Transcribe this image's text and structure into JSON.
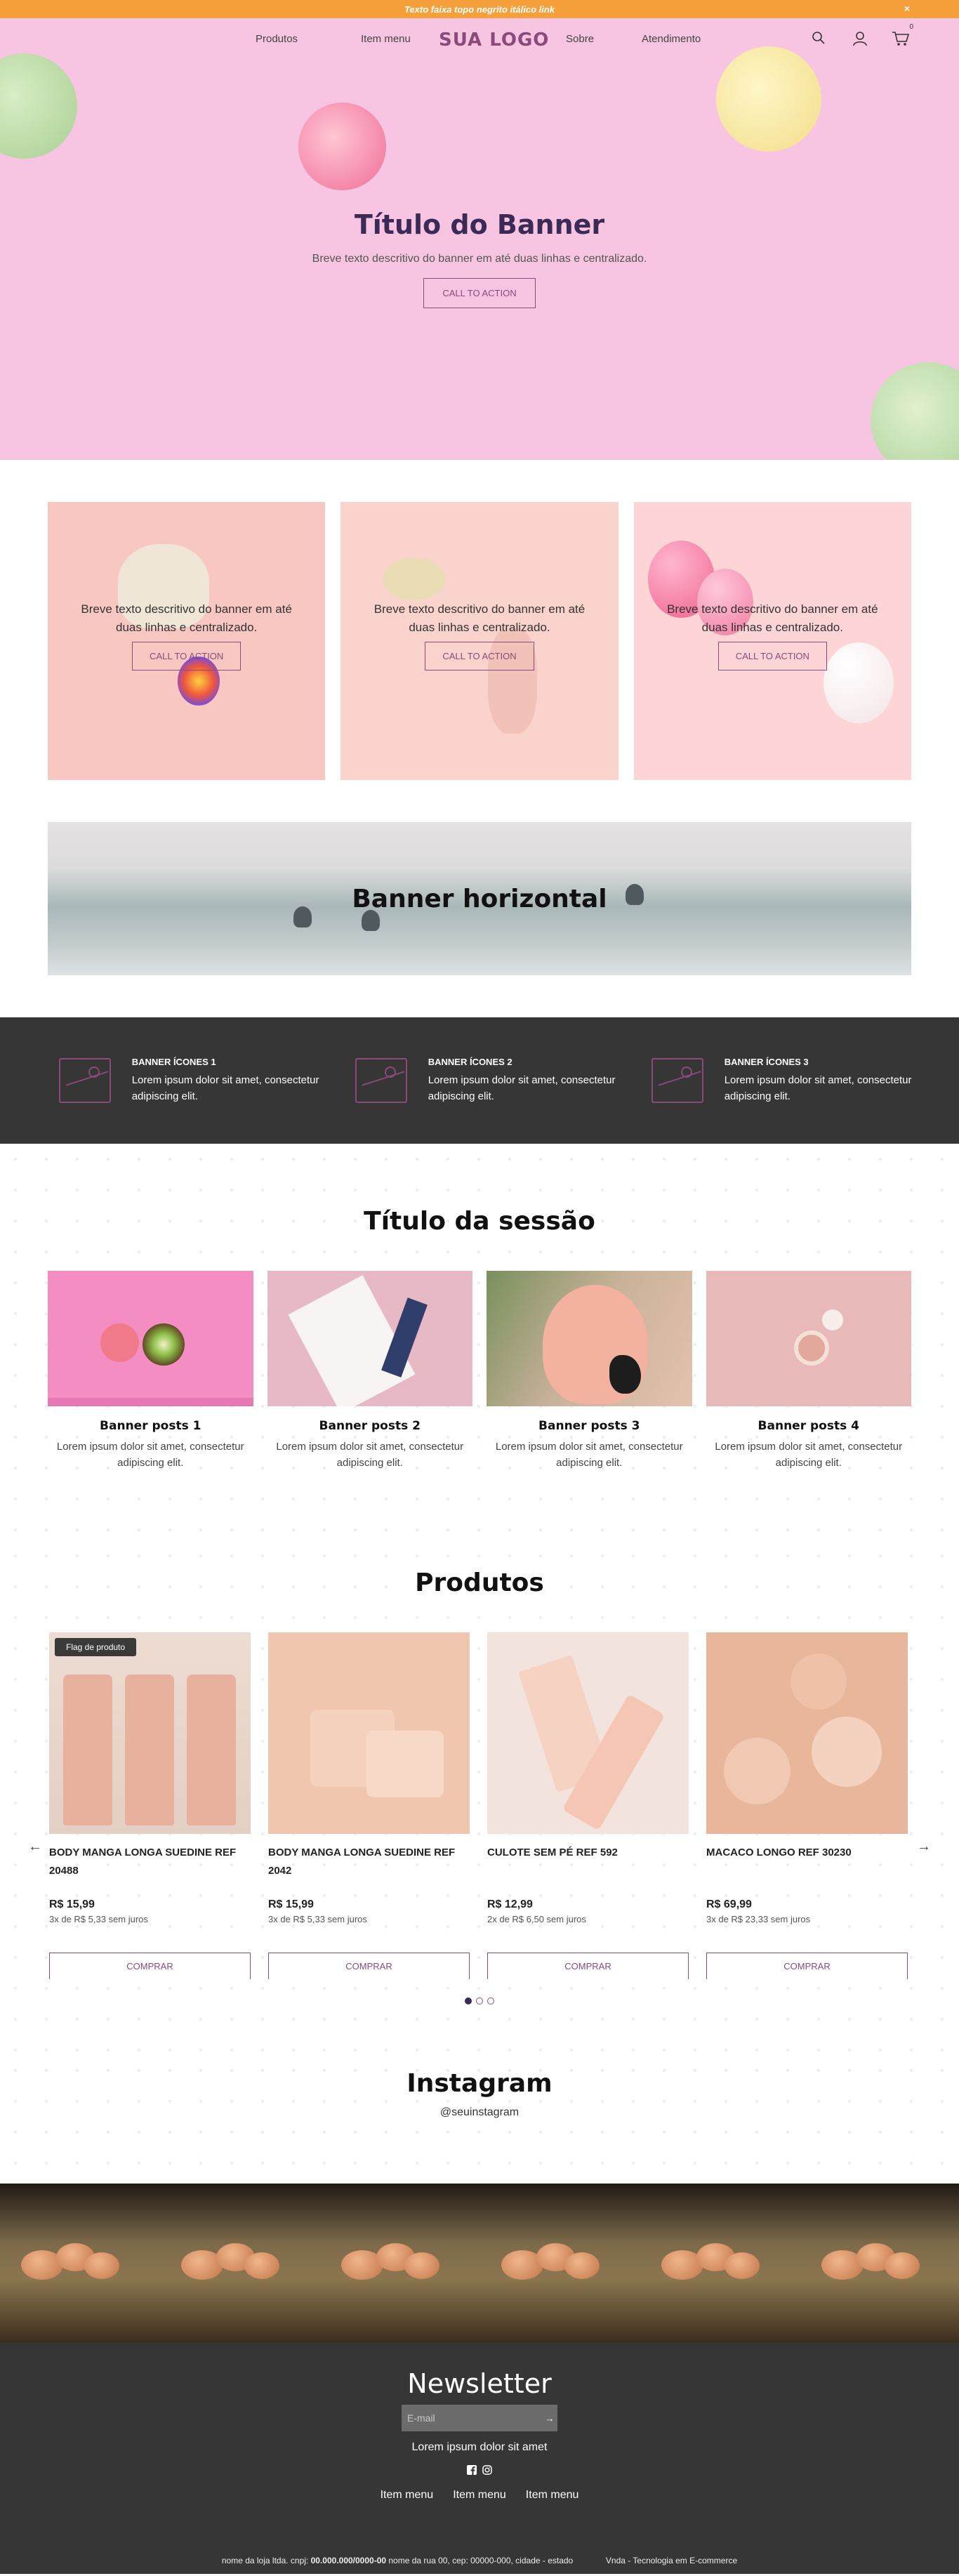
{
  "topbar": {
    "text": "Texto faixa topo negrito itálico link",
    "close_symbol": "×"
  },
  "header": {
    "nav_left": [
      "Produtos",
      "Item menu"
    ],
    "logo": "SUA LOGO",
    "nav_right": [
      "Sobre",
      "Atendimento"
    ],
    "cart_count": "0",
    "icons": [
      "search-icon",
      "user-icon",
      "cart-icon"
    ]
  },
  "hero": {
    "title": "Título do Banner",
    "text": "Breve texto descritivo do banner em até duas linhas e centralizado.",
    "cta": "CALL TO ACTION"
  },
  "banners": [
    {
      "text": "Breve texto descritivo do banner em até duas linhas e centralizado.",
      "cta": "CALL TO ACTION"
    },
    {
      "text": "Breve texto descritivo do banner em até duas linhas e centralizado.",
      "cta": "CALL TO ACTION"
    },
    {
      "text": "Breve texto descritivo do banner em até duas linhas e centralizado.",
      "cta": "CALL TO ACTION"
    }
  ],
  "horizontal_banner": {
    "title": "Banner horizontal"
  },
  "icon_banners": [
    {
      "title": "BANNER ÍCONES 1",
      "text": "Lorem ipsum dolor sit amet, consectetur adipiscing elit."
    },
    {
      "title": "BANNER ÍCONES 2",
      "text": "Lorem ipsum dolor sit amet, consectetur adipiscing elit."
    },
    {
      "title": "BANNER ÍCONES 3",
      "text": "Lorem ipsum dolor sit amet, consectetur adipiscing elit."
    }
  ],
  "posts_section": {
    "title": "Título da sessão",
    "posts": [
      {
        "title": "Banner posts 1",
        "text": "Lorem ipsum dolor sit amet, consectetur adipiscing elit."
      },
      {
        "title": "Banner posts 2",
        "text": "Lorem ipsum dolor sit amet, consectetur adipiscing elit."
      },
      {
        "title": "Banner posts 3",
        "text": "Lorem ipsum dolor sit amet, consectetur adipiscing elit."
      },
      {
        "title": "Banner posts 4",
        "text": "Lorem ipsum dolor sit amet, consectetur adipiscing elit."
      }
    ]
  },
  "products_section": {
    "title": "Produtos",
    "flag": "Flag de produto",
    "buy_label": "COMPRAR",
    "prev_arrow": "←",
    "next_arrow": "→",
    "products": [
      {
        "name": "BODY MANGA LONGA SUEDINE REF 20488",
        "price": "R$ 15,99",
        "installments": "3x de R$ 5,33 sem juros"
      },
      {
        "name": "BODY MANGA LONGA SUEDINE REF 2042",
        "price": "R$ 15,99",
        "installments": "3x de R$ 5,33 sem juros"
      },
      {
        "name": "CULOTE SEM PÉ REF 592",
        "price": "R$ 12,99",
        "installments": "2x de R$ 6,50 sem juros"
      },
      {
        "name": "MACACO LONGO REF 30230",
        "price": "R$ 69,99",
        "installments": "3x de R$ 23,33 sem juros"
      }
    ],
    "active_page": 1,
    "page_count": 3
  },
  "instagram": {
    "title": "Instagram",
    "handle": "@seuinstagram",
    "tile_count": 6
  },
  "footer": {
    "newsletter_title": "Newsletter",
    "email_placeholder": "E-mail",
    "send_symbol": "→",
    "newsletter_text": "Lorem ipsum dolor sit amet",
    "menu": [
      "Item menu",
      "Item menu",
      "Item menu"
    ],
    "company_prefix": "nome da loja ltda. cnpj: ",
    "company_cnpj": "00.000.000/0000-00",
    "company_suffix": " nome da rua 00, cep: 00000-000, cidade - estado",
    "credit": "Vnda - Tecnologia em E-commerce"
  },
  "colors": {
    "accent": "#8a4a7c",
    "topbar": "#f6a03c",
    "hero_bg": "#f7c4e1",
    "dark": "#363636",
    "heading": "#3a2a55"
  }
}
